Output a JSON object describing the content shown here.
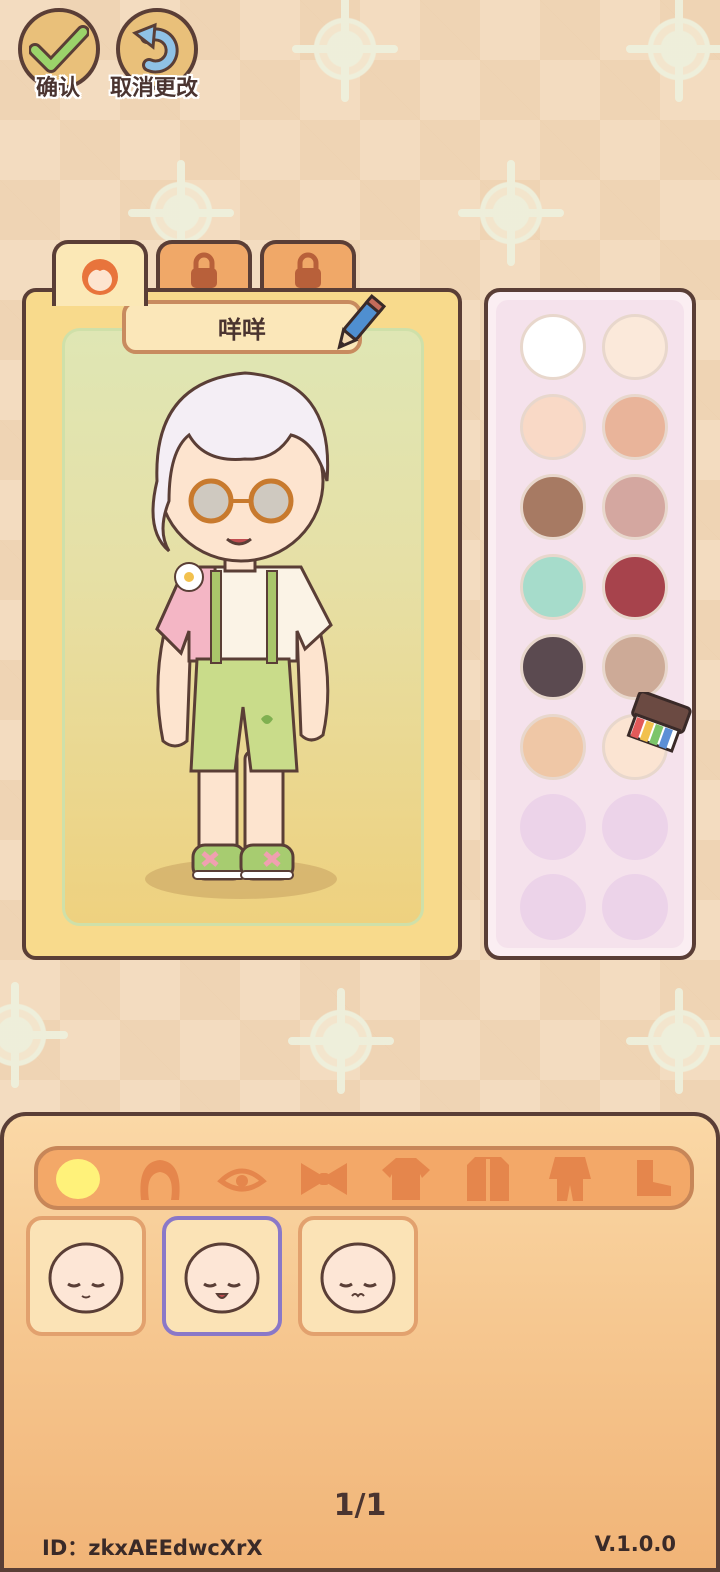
{
  "top_bar": {
    "confirm_label": "确认",
    "cancel_label": "取消更改"
  },
  "character_panel": {
    "name": "咩咩",
    "tabs": [
      {
        "icon": "face-icon",
        "locked": false
      },
      {
        "icon": "lock-icon",
        "locked": true
      },
      {
        "icon": "lock-icon",
        "locked": true
      }
    ]
  },
  "palette": {
    "colors": [
      "#ffffff",
      "#fbe9da",
      "#f9d9c6",
      "#e9b49a",
      "#a77a63",
      "#d4a7a0",
      "#a6dccb",
      "#a7434c",
      "#5b4a50",
      "#cdaa97",
      "#efc7a6",
      "#fbe4d2"
    ],
    "selected_index": 11,
    "empty_slots": 4
  },
  "categories": [
    "face-shape-icon",
    "hair-icon",
    "eyes-icon",
    "bow-icon",
    "top-icon",
    "outerwear-icon",
    "suit-icon",
    "shoes-icon"
  ],
  "face_options": [
    {
      "name": "face-option-1",
      "selected": false
    },
    {
      "name": "face-option-2",
      "selected": true
    },
    {
      "name": "face-option-3",
      "selected": false
    }
  ],
  "footer": {
    "page": "1/1",
    "id_text": "ID：zkxAEEdwcXrX",
    "version": "V.1.0.0"
  }
}
